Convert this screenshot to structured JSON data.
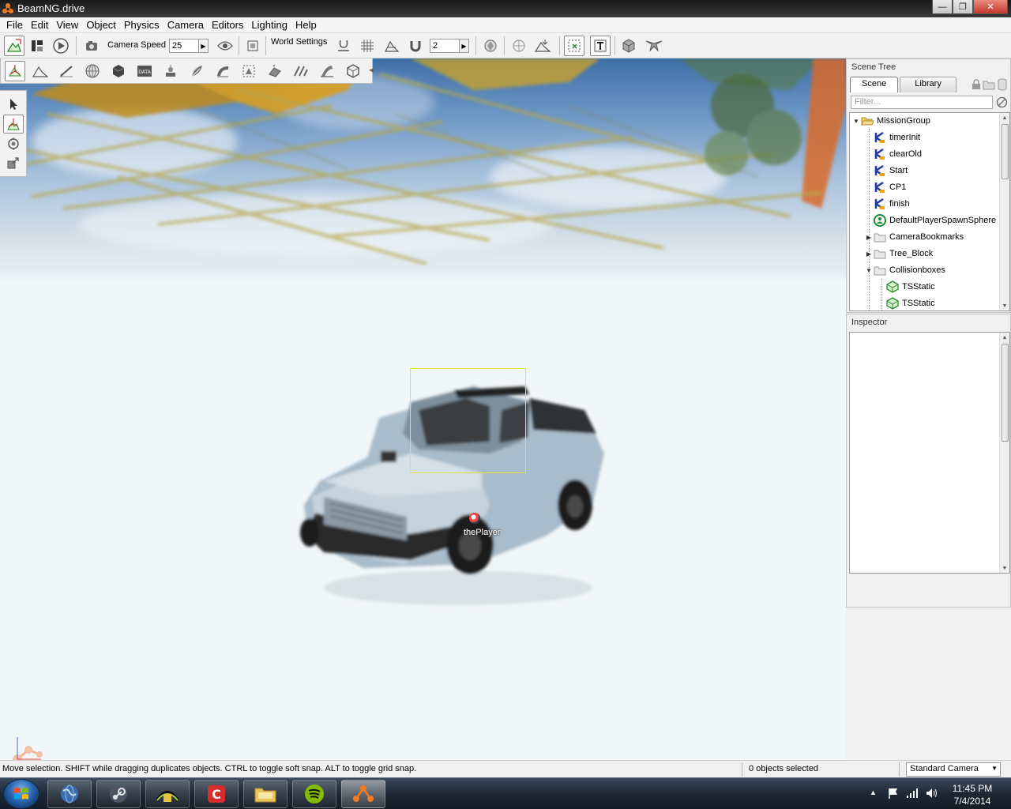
{
  "window": {
    "title": "BeamNG.drive"
  },
  "menu": [
    "File",
    "Edit",
    "View",
    "Object",
    "Physics",
    "Camera",
    "Editors",
    "Lighting",
    "Help"
  ],
  "toolbar": {
    "camera_speed_label": "Camera Speed",
    "camera_speed_value": "25",
    "world_settings_label": "World Settings",
    "snap_value": "2"
  },
  "viewport": {
    "player_label": "thePlayer"
  },
  "scene_tree": {
    "title": "Scene Tree",
    "tabs": [
      "Scene",
      "Library"
    ],
    "filter_placeholder": "Filter...",
    "items": [
      {
        "label": "MissionGroup",
        "depth": 0,
        "icon": "folder-open-icon",
        "twisty": "open"
      },
      {
        "label": "timerInit",
        "depth": 1,
        "icon": "trigger-icon",
        "twisty": ""
      },
      {
        "label": "clearOld",
        "depth": 1,
        "icon": "trigger-icon",
        "twisty": ""
      },
      {
        "label": "Start",
        "depth": 1,
        "icon": "trigger-icon",
        "twisty": ""
      },
      {
        "label": "CP1",
        "depth": 1,
        "icon": "trigger-icon",
        "twisty": ""
      },
      {
        "label": "finish",
        "depth": 1,
        "icon": "trigger-icon",
        "twisty": ""
      },
      {
        "label": "DefaultPlayerSpawnSphere",
        "depth": 1,
        "icon": "spawn-sphere-icon",
        "twisty": ""
      },
      {
        "label": "CameraBookmarks",
        "depth": 1,
        "icon": "folder-icon",
        "twisty": "closed"
      },
      {
        "label": "Tree_Block",
        "depth": 1,
        "icon": "folder-icon",
        "twisty": "closed"
      },
      {
        "label": "Collisionboxes",
        "depth": 1,
        "icon": "folder-icon",
        "twisty": "open"
      },
      {
        "label": "TSStatic",
        "depth": 2,
        "icon": "tsstatic-icon",
        "twisty": ""
      },
      {
        "label": "TSStatic",
        "depth": 2,
        "icon": "tsstatic-icon",
        "twisty": ""
      }
    ]
  },
  "inspector": {
    "title": "Inspector"
  },
  "status": {
    "message": "Move selection.  SHIFT while dragging duplicates objects.  CTRL to toggle soft snap.  ALT to toggle grid snap.",
    "selected_count": "0 objects selected",
    "camera_mode": "Standard Camera"
  },
  "taskbar": {
    "clock_time": "11:45 PM",
    "clock_date": "7/4/2014",
    "apps": [
      "browser-globe-icon",
      "steam-icon",
      "asrock-icon",
      "c-app-icon",
      "file-explorer-icon",
      "spotify-icon",
      "beamng-icon"
    ]
  },
  "colors": {
    "selection_box": "#e6e63a",
    "sky_top": "#3d6fa8",
    "ground": "#f1f6f8"
  }
}
